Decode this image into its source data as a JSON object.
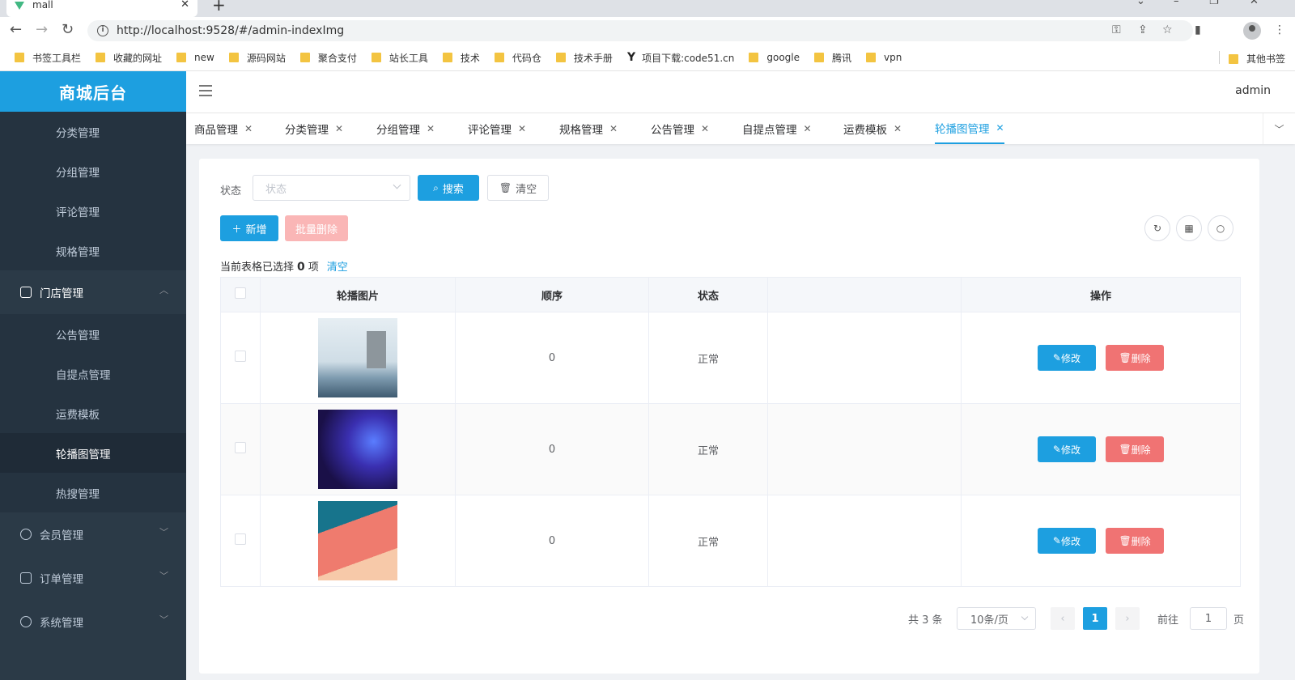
{
  "browser": {
    "tab_title": "mall",
    "url": "http://localhost:9528/#/admin-indexImg",
    "bookmarks": [
      "书签工具栏",
      "收藏的网址",
      "new",
      "源码网站",
      "聚合支付",
      "站长工具",
      "技术",
      "代码仓",
      "技术手册",
      "项目下载:code51.cn",
      "google",
      "腾讯",
      "vpn"
    ],
    "other_bookmarks": "其他书签"
  },
  "sidebar": {
    "logo": "商城后台",
    "items": [
      {
        "label": "分类管理",
        "type": "sub"
      },
      {
        "label": "分组管理",
        "type": "sub"
      },
      {
        "label": "评论管理",
        "type": "sub"
      },
      {
        "label": "规格管理",
        "type": "sub"
      },
      {
        "label": "门店管理",
        "type": "top",
        "open": true
      },
      {
        "label": "公告管理",
        "type": "sub"
      },
      {
        "label": "自提点管理",
        "type": "sub"
      },
      {
        "label": "运费模板",
        "type": "sub"
      },
      {
        "label": "轮播图管理",
        "type": "sub",
        "active": true
      },
      {
        "label": "热搜管理",
        "type": "sub"
      },
      {
        "label": "会员管理",
        "type": "top"
      },
      {
        "label": "订单管理",
        "type": "top"
      },
      {
        "label": "系统管理",
        "type": "top"
      }
    ]
  },
  "header": {
    "user": "admin"
  },
  "tags": [
    "商品管理",
    "分类管理",
    "分组管理",
    "评论管理",
    "规格管理",
    "公告管理",
    "自提点管理",
    "运费模板",
    "轮播图管理"
  ],
  "filter": {
    "status_label": "状态",
    "status_placeholder": "状态",
    "search_label": "搜索",
    "clear_label": "清空"
  },
  "toolbar": {
    "add_label": "新增",
    "batch_delete_label": "批量删除"
  },
  "selection": {
    "prefix": "当前表格已选择",
    "count": "0",
    "suffix": "项",
    "clear_label": "清空"
  },
  "table": {
    "headers": [
      "轮播图片",
      "顺序",
      "状态",
      "",
      "操作"
    ],
    "edit_label": "修改",
    "delete_label": "删除",
    "rows": [
      {
        "order": "0",
        "status": "正常"
      },
      {
        "order": "0",
        "status": "正常"
      },
      {
        "order": "0",
        "status": "正常"
      }
    ]
  },
  "pagination": {
    "total": "共 3 条",
    "page_size": "10条/页",
    "current_page": "1",
    "goto_prefix": "前往",
    "goto_value": "1",
    "goto_suffix": "页"
  },
  "colors": {
    "primary": "#1d9fe0",
    "danger": "#f07373",
    "sidebar_bg": "#2b3a47"
  }
}
